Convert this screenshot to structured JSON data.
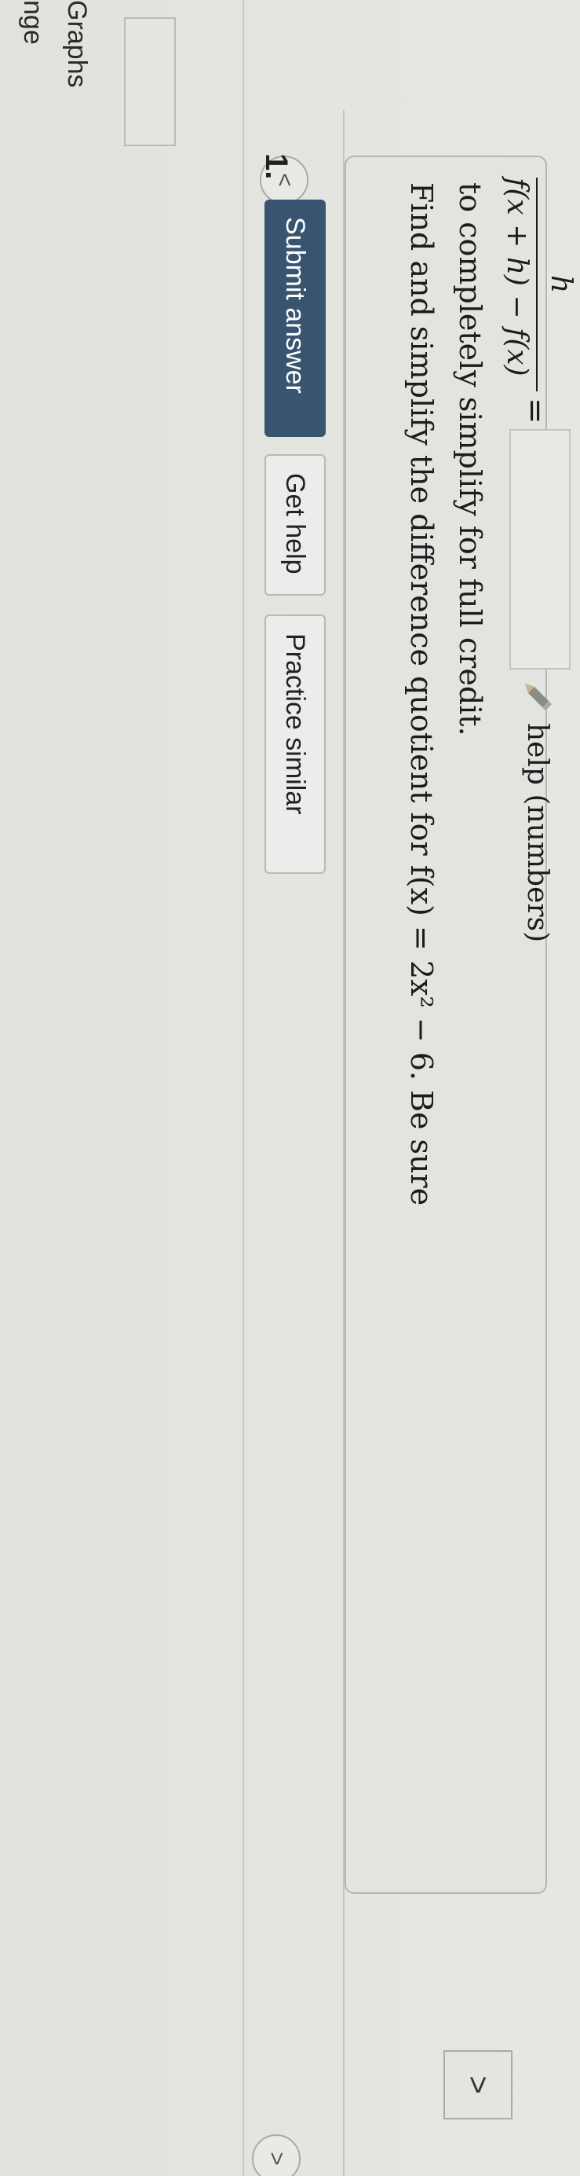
{
  "sidebar": {
    "label_1": "nge",
    "label_2": "Graphs"
  },
  "nav": {
    "prev_symbol": "<",
    "next_symbol": ">",
    "next_symbol_2": ">"
  },
  "question": {
    "number": "1.",
    "submit_label": "Submit answer",
    "get_help_label": "Get help",
    "practice_label": "Practice similar",
    "prompt_line_1": "Find and simplify the difference quotient for f(x) = 2x² − 6. Be sure",
    "prompt_line_2": "to completely simplify for full credit.",
    "fraction_numerator": "f(x + h) − f(x)",
    "fraction_denominator": "h",
    "equals": "=",
    "answer_value": "",
    "help_link": "help (numbers)"
  },
  "colors": {
    "submit_bg": "#39546f",
    "page_bg": "#e3e4e0"
  },
  "icons": {
    "pencil": "pencil-icon"
  }
}
